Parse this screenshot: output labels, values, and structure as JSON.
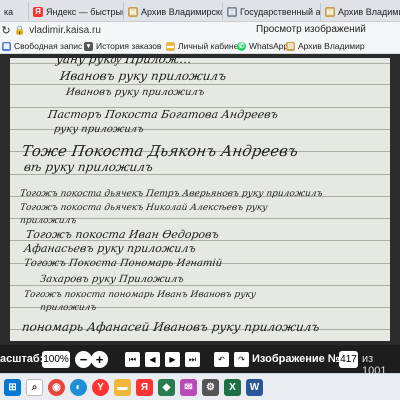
{
  "browser": {
    "tabs": [
      {
        "label": "ка",
        "icon": "document-icon",
        "color": "#5b7fb5"
      },
      {
        "label": "Яндекс — быстрый поис",
        "icon": "yandex-icon",
        "color": "#ff3333"
      },
      {
        "label": "Архив Владимирской",
        "icon": "archive-icon",
        "color": "#c9a24d"
      },
      {
        "label": "Государственный архи",
        "icon": "archive-icon",
        "color": "#7a8a9a"
      },
      {
        "label": "Архив Владимирской о",
        "icon": "archive-icon",
        "color": "#c9a24d"
      }
    ],
    "address": {
      "url": "vladimir.kaisa.ru",
      "page_title": "Просмотр изображений"
    },
    "bookmarks": [
      {
        "label": "Свободная запис",
        "icon": "calendar-icon",
        "color": "#4f7ad9"
      },
      {
        "label": "История заказов",
        "icon": "cart-icon",
        "color": "#555555"
      },
      {
        "label": "Личный кабинет",
        "icon": "folder-icon",
        "color": "#e8b84a"
      },
      {
        "label": "WhatsApp",
        "icon": "whatsapp-icon",
        "color": "#25d366"
      },
      {
        "label": "Архив Владимир",
        "icon": "archive-icon",
        "color": "#c9a24d"
      }
    ]
  },
  "document_lines": [
    {
      "text": "уану рукѹ Прилож…",
      "cls": "line-0"
    },
    {
      "text": "Ивановъ руку приложилъ",
      "cls": "line-1"
    },
    {
      "text": "Ивановъ руку приложилъ",
      "cls": "line-2"
    },
    {
      "text": "Пасторъ Покоста Богатова Андреевъ",
      "cls": "line-3"
    },
    {
      "text": "руку приложилъ",
      "cls": "line-4"
    },
    {
      "text": "Тоже Покоста Дьяконъ Андреевъ",
      "cls": "line-5"
    },
    {
      "text": "вѣ руку приложилъ",
      "cls": "line-6"
    },
    {
      "text": "Тогожъ покоста дьячекъ Петръ Аверьяновъ руку приложилъ",
      "cls": "line-7"
    },
    {
      "text": "Тогожъ покоста дьячекъ Николай Алексѣевъ руку",
      "cls": "line-8"
    },
    {
      "text": "приложилъ",
      "cls": "line-9"
    },
    {
      "text": "Тогожъ покоста Иван Ѳедоровъ",
      "cls": "line-10"
    },
    {
      "text": "Афанасьевъ руку приложилъ",
      "cls": "line-11"
    },
    {
      "text": "Тогожъ Покоста Пономарь Игнатій",
      "cls": "line-12"
    },
    {
      "text": "Захаровъ руку Приложилъ",
      "cls": "line-13"
    },
    {
      "text": "Тогожъ покоста пономарь Иванъ Ивановъ руку",
      "cls": "line-14"
    },
    {
      "text": "приложилъ",
      "cls": "line-15"
    },
    {
      "text": "пономарь Афанасей Ивановъ руку приложилъ",
      "cls": "line-16"
    }
  ],
  "toolbar": {
    "zoom_label": "асштаб:",
    "zoom_value": "100%",
    "minus": "−",
    "plus": "+",
    "image_label": "Изображение №:",
    "image_number": "417",
    "of_text": "из 1001"
  },
  "taskbar_apps": [
    {
      "name": "windows-start-icon",
      "glyph": "⊞",
      "color": "#0078d4"
    },
    {
      "name": "search-icon",
      "glyph": "⌕",
      "color": "#333333"
    },
    {
      "name": "chrome-icon",
      "glyph": "◉",
      "color": "#e8453c"
    },
    {
      "name": "edge-icon",
      "glyph": "◐",
      "color": "#1f8fd6"
    },
    {
      "name": "yandex-browser-icon",
      "glyph": "Y",
      "color": "#ff3333"
    },
    {
      "name": "file-explorer-icon",
      "glyph": "▬",
      "color": "#f0b73a"
    },
    {
      "name": "yandex-icon",
      "glyph": "Я",
      "color": "#ff3333"
    },
    {
      "name": "app-icon",
      "glyph": "◆",
      "color": "#2a7b4f"
    },
    {
      "name": "mail-icon",
      "glyph": "✉",
      "color": "#b84bb8"
    },
    {
      "name": "settings-icon",
      "glyph": "⚙",
      "color": "#555555"
    },
    {
      "name": "excel-icon",
      "glyph": "X",
      "color": "#1e7145"
    },
    {
      "name": "word-icon",
      "glyph": "W",
      "color": "#2b579a"
    }
  ]
}
